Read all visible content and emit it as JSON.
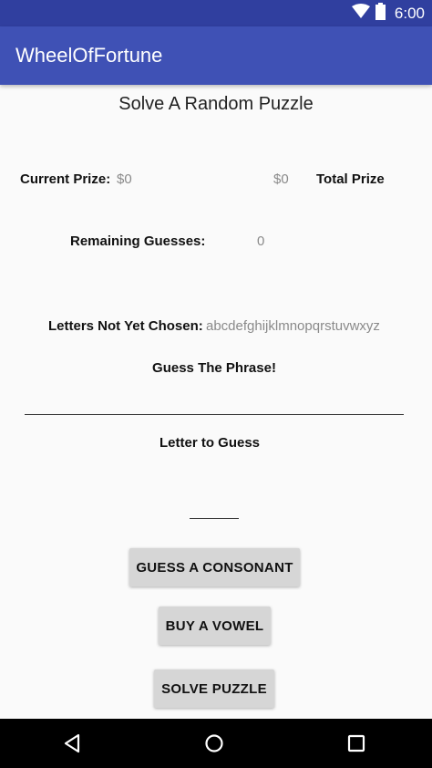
{
  "status_bar": {
    "time": "6:00",
    "icons": [
      "wifi-icon",
      "battery-icon"
    ]
  },
  "app_bar": {
    "title": "WheelOfFortune"
  },
  "main": {
    "subtitle": "Solve A Random Puzzle",
    "current_prize_label": "Current Prize:",
    "current_prize_value": "$0",
    "total_prize_value": "$0",
    "total_prize_label": "Total Prize",
    "remaining_guesses_label": "Remaining Guesses:",
    "remaining_guesses_value": "0",
    "letters_not_chosen_label": "Letters Not Yet Chosen:",
    "letters_not_chosen_value": "abcdefghijklmnopqrstuvwxyz",
    "guess_phrase_label": "Guess The Phrase!",
    "letter_to_guess_label": "Letter to Guess"
  },
  "buttons": {
    "guess_consonant": "GUESS A CONSONANT",
    "buy_vowel": "BUY A VOWEL",
    "solve_puzzle": "SOLVE PUZZLE"
  },
  "nav_bar": {
    "icons": [
      "back-icon",
      "home-icon",
      "recents-icon"
    ]
  },
  "colors": {
    "status_bar": "#303f9f",
    "app_bar": "#3f51b5",
    "button": "#d6d6d6",
    "muted_text": "#8a8a8a"
  }
}
